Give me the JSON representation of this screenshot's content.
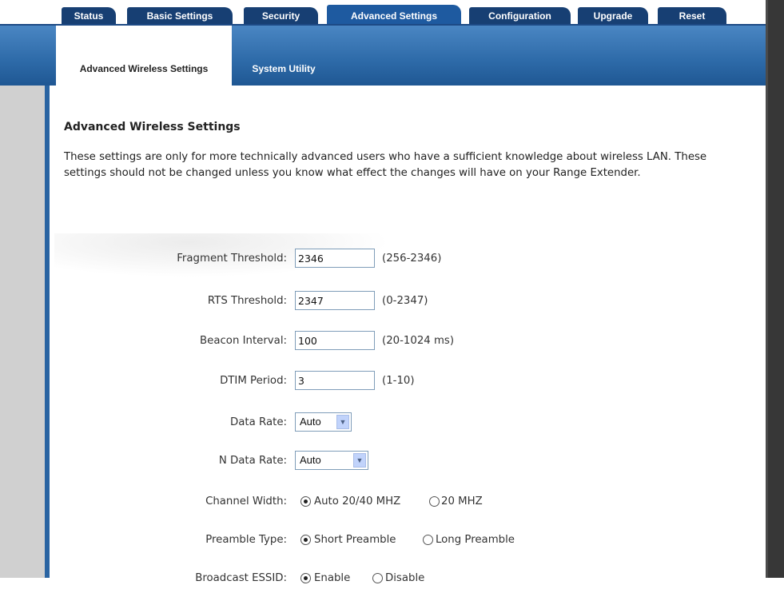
{
  "top_tabs": [
    {
      "label": "Status"
    },
    {
      "label": "Basic Settings"
    },
    {
      "label": "Security"
    },
    {
      "label": "Advanced Settings",
      "active": true
    },
    {
      "label": "Configuration"
    },
    {
      "label": "Upgrade"
    },
    {
      "label": "Reset"
    }
  ],
  "sub_tabs": [
    {
      "label": "Advanced Wireless Settings",
      "active": true
    },
    {
      "label": "System Utility"
    }
  ],
  "page": {
    "title": "Advanced Wireless Settings",
    "description": "These settings are only for more technically advanced users who have a sufficient knowledge about wireless LAN. These settings should not be changed unless you know what effect the changes will have on your Range Extender."
  },
  "fields": {
    "fragment": {
      "label": "Fragment Threshold:",
      "value": "2346",
      "range": "(256-2346)"
    },
    "rts": {
      "label": "RTS Threshold:",
      "value": "2347",
      "range": "(0-2347)"
    },
    "beacon": {
      "label": "Beacon Interval:",
      "value": "100",
      "range": "(20-1024 ms)"
    },
    "dtim": {
      "label": "DTIM Period:",
      "value": "3",
      "range": "(1-10)"
    },
    "data_rate": {
      "label": "Data Rate:",
      "value": "Auto"
    },
    "n_data_rate": {
      "label": "N Data Rate:",
      "value": "Auto"
    },
    "channel_width": {
      "label": "Channel Width:",
      "options": [
        "Auto 20/40 MHZ",
        "20 MHZ"
      ],
      "selected": "Auto 20/40 MHZ"
    },
    "preamble": {
      "label": "Preamble Type:",
      "options": [
        "Short Preamble",
        "Long Preamble"
      ],
      "selected": "Short Preamble"
    },
    "broadcast": {
      "label": "Broadcast ESSID:",
      "options": [
        "Enable",
        "Disable"
      ],
      "selected": "Enable"
    }
  },
  "colors": {
    "tab_dark": "#173f73",
    "tab_active": "#1e5aa0",
    "band": "#2d6aa8",
    "left_panel": "#d0d0d0",
    "right_bar": "#373737"
  }
}
